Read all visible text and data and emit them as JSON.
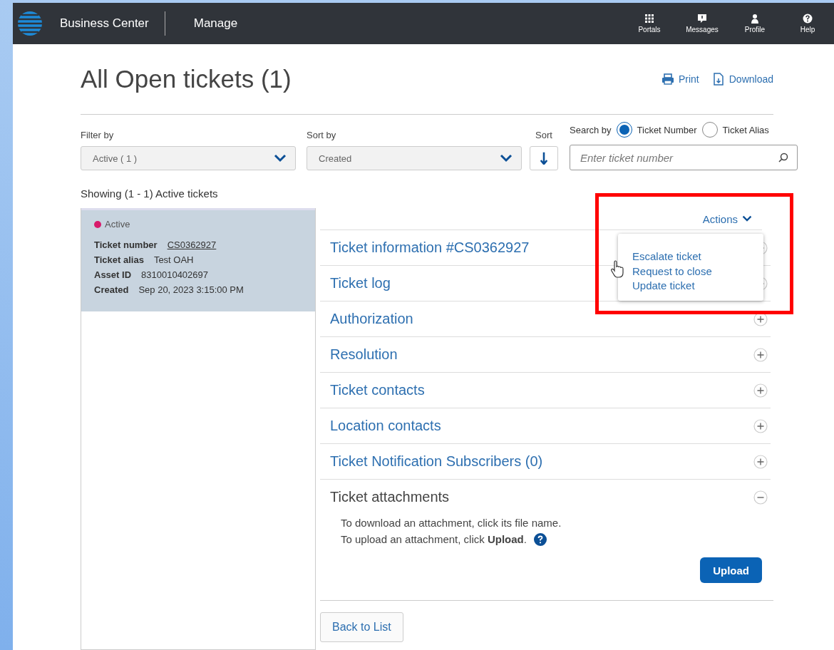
{
  "header": {
    "brand": "Business Center",
    "nav_link": "Manage",
    "icons": [
      {
        "label": "Portals",
        "kind": "grid"
      },
      {
        "label": "Messages",
        "kind": "message"
      },
      {
        "label": "Profile",
        "kind": "person"
      },
      {
        "label": "Help",
        "kind": "help"
      }
    ]
  },
  "page": {
    "title": "All Open tickets (1)",
    "links": [
      {
        "label": "Print",
        "kind": "print"
      },
      {
        "label": "Download",
        "kind": "download"
      }
    ]
  },
  "filters": {
    "filter": {
      "label": "Filter by",
      "value": "Active ( 1 )"
    },
    "sort_by": {
      "label": "Sort by",
      "value": "Created"
    },
    "sort": {
      "label": "Sort"
    },
    "search_by": {
      "label": "Search by",
      "options": [
        {
          "label": "Ticket Number",
          "selected": true
        },
        {
          "label": "Ticket Alias",
          "selected": false
        }
      ]
    },
    "search": {
      "placeholder": "Enter ticket number"
    }
  },
  "showing": "Showing (1 - 1) Active tickets",
  "tickets": [
    {
      "status": "Active",
      "color": "#d81b6b",
      "selected": true,
      "fields": [
        {
          "label": "Ticket number",
          "value": "CS0362927",
          "kind": "link"
        },
        {
          "label": "Ticket alias",
          "value": "Test OAH",
          "kind": "text"
        },
        {
          "label": "Asset ID",
          "value": "8310010402697",
          "kind": "text"
        },
        {
          "label": "Created",
          "value": "Sep 20, 2023 3:15:00 PM",
          "kind": "text"
        }
      ]
    }
  ],
  "actions": {
    "label": "Actions",
    "expanded": true,
    "items": [
      "Escalate ticket",
      "Request to close",
      "Update ticket"
    ]
  },
  "sections": [
    {
      "title": "Ticket information #CS0362927",
      "expanded": false
    },
    {
      "title": "Ticket log",
      "expanded": false
    },
    {
      "title": "Authorization",
      "expanded": false
    },
    {
      "title": "Resolution",
      "expanded": false
    },
    {
      "title": "Ticket contacts",
      "expanded": false
    },
    {
      "title": "Location contacts",
      "expanded": false
    },
    {
      "title": "Ticket Notification Subscribers (0)",
      "expanded": false
    },
    {
      "title": "Ticket attachments",
      "expanded": true,
      "lines": [
        "To download an attachment, click its file name.",
        "To upload an attachment, click **Upload**."
      ],
      "button": "Upload"
    }
  ],
  "back_button": "Back to List"
}
